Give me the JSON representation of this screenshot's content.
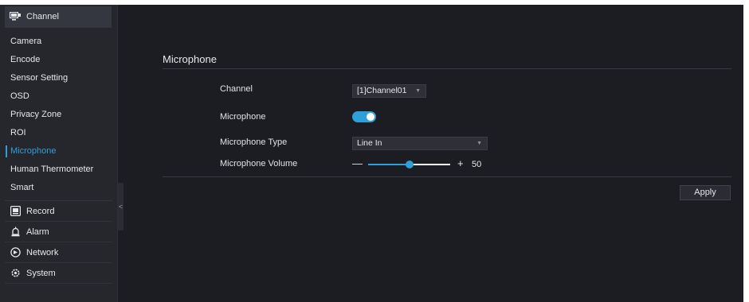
{
  "sidebar": {
    "channel_label": "Channel",
    "channel_items": [
      {
        "label": "Camera"
      },
      {
        "label": "Encode"
      },
      {
        "label": "Sensor Setting"
      },
      {
        "label": "OSD"
      },
      {
        "label": "Privacy Zone"
      },
      {
        "label": "ROI"
      },
      {
        "label": "Microphone"
      },
      {
        "label": "Human Thermometer"
      },
      {
        "label": "Smart"
      }
    ],
    "active_item": "Microphone",
    "groups": [
      {
        "label": "Record",
        "icon": "record-icon"
      },
      {
        "label": "Alarm",
        "icon": "alarm-icon"
      },
      {
        "label": "Network",
        "icon": "network-icon"
      },
      {
        "label": "System",
        "icon": "system-icon"
      }
    ],
    "collapse_glyph": "<"
  },
  "main": {
    "title": "Microphone",
    "channel": {
      "label": "Channel",
      "value": "[1]Channel01"
    },
    "microphone": {
      "label": "Microphone",
      "enabled": true
    },
    "microphone_type": {
      "label": "Microphone Type",
      "value": "Line In"
    },
    "volume": {
      "label": "Microphone Volume",
      "minus": "—",
      "plus": "+",
      "value": "50",
      "level": 50
    },
    "apply_label": "Apply"
  },
  "colors": {
    "accent": "#2f9fd8",
    "background": "#1c1d22",
    "sidebar": "#26272d"
  }
}
